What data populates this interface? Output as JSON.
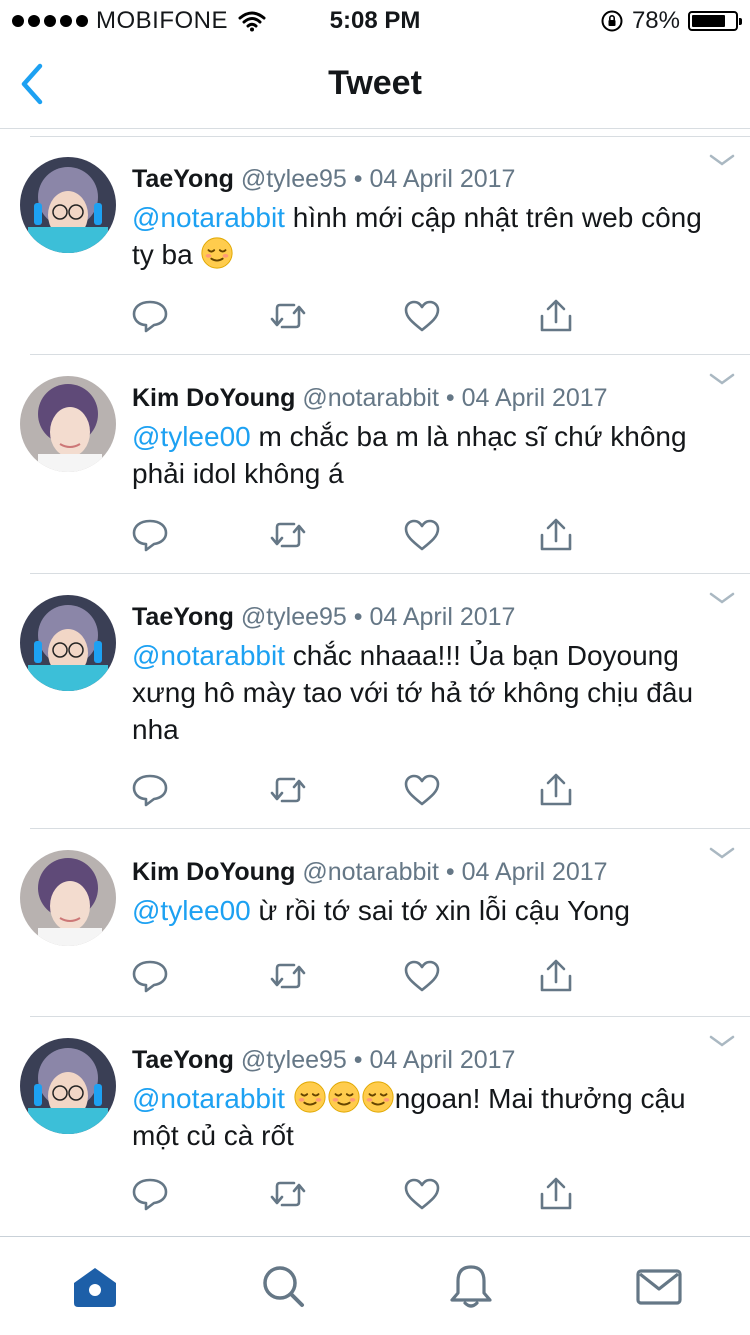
{
  "status_bar": {
    "carrier": "MOBIFONE",
    "time": "5:08 PM",
    "battery": "78%",
    "battery_level": 0.78
  },
  "nav": {
    "title": "Tweet",
    "back_icon": "chevron-left-icon"
  },
  "colors": {
    "accent": "#1da1f2",
    "secondary_text": "#657786",
    "divider": "#d8dde1"
  },
  "tweets": [
    {
      "name": "TaeYong",
      "handle": "@tylee95",
      "separator": "•",
      "date": "04 April 2017",
      "mention": "@notarabbit",
      "text": " hình mới cập nhật trên web công ty ba ",
      "emoji_count": 1,
      "text_after": ""
    },
    {
      "name": "Kim DoYoung",
      "handle": "@notarabbit",
      "separator": "•",
      "date": "04 April 2017",
      "mention": "@tylee00",
      "text": " m chắc ba m là nhạc sĩ chứ không phải idol không á",
      "emoji_count": 0,
      "text_after": ""
    },
    {
      "name": "TaeYong",
      "handle": "@tylee95",
      "separator": "•",
      "date": "04 April 2017",
      "mention": "@notarabbit",
      "text": " chắc nhaaa!!! Ủa bạn Doyoung xưng hô mày tao với tớ hả tớ không chịu đâu nha",
      "emoji_count": 0,
      "text_after": ""
    },
    {
      "name": "Kim DoYoung",
      "handle": "@notarabbit",
      "separator": "•",
      "date": "04 April 2017",
      "mention": "@tylee00",
      "text": " ừ rồi tớ sai tớ xin lỗi cậu Yong",
      "emoji_count": 0,
      "text_after": ""
    },
    {
      "name": "TaeYong",
      "handle": "@tylee95",
      "separator": "•",
      "date": "04 April 2017",
      "mention": "@notarabbit",
      "text": " ",
      "emoji_count": 3,
      "text_after": "ngoan! Mai thưởng cậu một củ cà rốt"
    }
  ],
  "tweet_actions": [
    "reply-icon",
    "retweet-icon",
    "like-icon",
    "share-icon"
  ],
  "tab_bar": [
    "home-icon",
    "search-icon",
    "notifications-icon",
    "messages-icon"
  ]
}
